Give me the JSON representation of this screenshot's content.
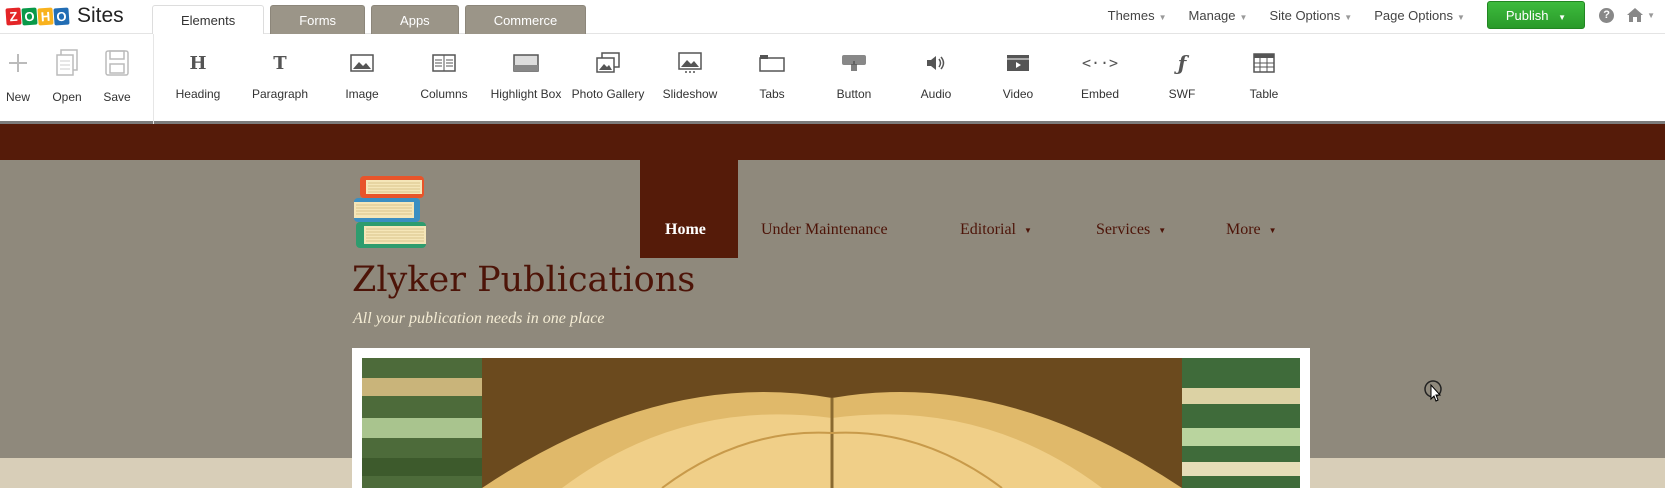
{
  "app": {
    "brand": "Sites",
    "zoho_letters": [
      "Z",
      "O",
      "H",
      "O"
    ],
    "zoho_colors": [
      "#e42527",
      "#089949",
      "#f9b21d",
      "#226db4"
    ]
  },
  "tabs": [
    {
      "label": "Elements",
      "active": true
    },
    {
      "label": "Forms",
      "active": false
    },
    {
      "label": "Apps",
      "active": false
    },
    {
      "label": "Commerce",
      "active": false
    }
  ],
  "topnav": {
    "themes": "Themes",
    "manage": "Manage",
    "site_options": "Site Options",
    "page_options": "Page Options",
    "publish": "Publish",
    "help": "?"
  },
  "file_tools": [
    {
      "label": "New",
      "icon": "plus-icon"
    },
    {
      "label": "Open",
      "icon": "open-document-icon"
    },
    {
      "label": "Save",
      "icon": "floppy-disk-icon"
    }
  ],
  "elements": [
    {
      "label": "Heading",
      "icon": "heading-icon"
    },
    {
      "label": "Paragraph",
      "icon": "paragraph-icon"
    },
    {
      "label": "Image",
      "icon": "image-icon"
    },
    {
      "label": "Columns",
      "icon": "columns-icon"
    },
    {
      "label": "Highlight Box",
      "icon": "highlight-box-icon"
    },
    {
      "label": "Photo Gallery",
      "icon": "photo-gallery-icon"
    },
    {
      "label": "Slideshow",
      "icon": "slideshow-icon"
    },
    {
      "label": "Tabs",
      "icon": "tabs-icon"
    },
    {
      "label": "Button",
      "icon": "button-icon"
    },
    {
      "label": "Audio",
      "icon": "audio-icon"
    },
    {
      "label": "Video",
      "icon": "video-icon"
    },
    {
      "label": "Embed",
      "icon": "embed-icon"
    },
    {
      "label": "SWF",
      "icon": "swf-icon"
    },
    {
      "label": "Table",
      "icon": "table-icon"
    }
  ],
  "site": {
    "title": "Zlyker Publications",
    "tagline": "All your publication needs in one place",
    "nav": [
      "Home",
      "Under Maintenance",
      "Editorial",
      "Services",
      "More"
    ]
  },
  "colors": {
    "header_band": "#551b09",
    "site_background": "#8f897c",
    "publish_green": "#2ea82e"
  }
}
